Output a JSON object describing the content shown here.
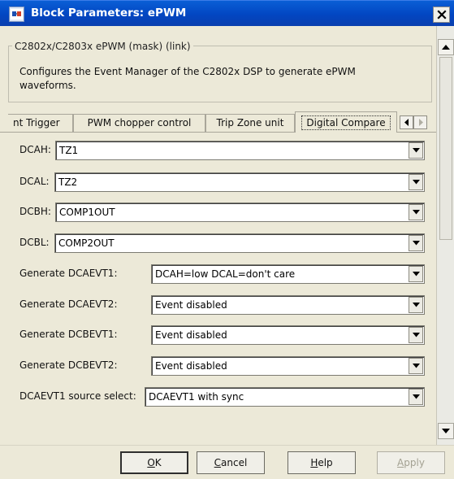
{
  "window": {
    "title": "Block Parameters: ePWM"
  },
  "mask": {
    "title": "C2802x/C2803x ePWM (mask) (link)",
    "description": "Configures the Event Manager of the C2802x DSP to generate ePWM waveforms."
  },
  "tabs": [
    {
      "label": "nt Trigger"
    },
    {
      "label": "PWM chopper control"
    },
    {
      "label": "Trip Zone unit"
    },
    {
      "label": "Digital Compare",
      "active": true
    }
  ],
  "fields": [
    {
      "label": "DCAH:",
      "value": "TZ1"
    },
    {
      "label": "DCAL:",
      "value": "TZ2"
    },
    {
      "label": "DCBH:",
      "value": "COMP1OUT"
    },
    {
      "label": "DCBL:",
      "value": "COMP2OUT"
    },
    {
      "label": "Generate DCAEVT1:",
      "value": "DCAH=low DCAL=don't care"
    },
    {
      "label": "Generate DCAEVT2:",
      "value": "Event disabled"
    },
    {
      "label": "Generate DCBEVT1:",
      "value": "Event disabled"
    },
    {
      "label": "Generate DCBEVT2:",
      "value": "Event disabled"
    },
    {
      "label": "DCAEVT1 source select:",
      "value": "DCAEVT1 with sync"
    }
  ],
  "buttons": {
    "ok": "OK",
    "cancel": "Cancel",
    "help": "Help",
    "apply": "Apply"
  },
  "icons": {
    "app": "simulink-block-icon",
    "close": "close-icon",
    "dropdown": "chevron-down-icon",
    "scroll_up": "arrow-up-icon",
    "scroll_down": "arrow-down-icon",
    "tab_left": "arrow-left-icon",
    "tab_right": "arrow-right-icon"
  },
  "colors": {
    "titlebar": "#0246c2",
    "dialog_bg": "#ece9d8",
    "field_bg": "#ffffff",
    "disabled_text": "#a3a192"
  }
}
